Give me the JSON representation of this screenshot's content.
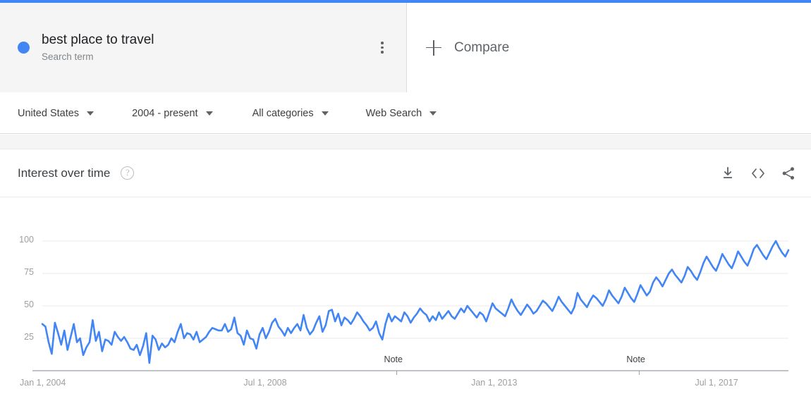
{
  "terms": {
    "items": [
      {
        "title": "best place to travel",
        "subtitle": "Search term",
        "color": "#4285f4",
        "menu_icon": "kebab-menu-icon"
      }
    ],
    "compare_label": "Compare",
    "compare_icon": "plus-icon"
  },
  "filters": [
    {
      "label": "United States",
      "name": "location"
    },
    {
      "label": "2004 - present",
      "name": "time-range"
    },
    {
      "label": "All categories",
      "name": "category"
    },
    {
      "label": "Web Search",
      "name": "search-type"
    }
  ],
  "chart_header": {
    "title": "Interest over time",
    "help_icon": "question-mark-icon",
    "actions": [
      {
        "name": "download-csv-button",
        "icon": "download-icon"
      },
      {
        "name": "embed-button",
        "icon": "code-embed-icon"
      },
      {
        "name": "share-button",
        "icon": "share-icon"
      }
    ]
  },
  "chart_data": {
    "type": "line",
    "title": "Interest over time",
    "xlabel": "",
    "ylabel": "",
    "ylim": [
      0,
      100
    ],
    "yticks": [
      25,
      50,
      75,
      100
    ],
    "grid": true,
    "legend": false,
    "line_color": "#4285f4",
    "xticks": [
      "Jan 1, 2004",
      "Jul 1, 2008",
      "Jan 1, 2013",
      "Jul 1, 2017"
    ],
    "xtick_positions": [
      0,
      0.3,
      0.605,
      0.905
    ],
    "annotations": [
      {
        "label": "Note",
        "position": 0.475
      },
      {
        "label": "Note",
        "position": 0.8
      }
    ],
    "series": [
      {
        "name": "best place to travel",
        "values": [
          36,
          34,
          22,
          13,
          37,
          29,
          20,
          31,
          16,
          26,
          36,
          22,
          25,
          12,
          18,
          22,
          39,
          23,
          30,
          15,
          24,
          23,
          20,
          30,
          26,
          23,
          26,
          22,
          17,
          16,
          20,
          12,
          19,
          29,
          6,
          27,
          24,
          16,
          21,
          18,
          20,
          25,
          22,
          30,
          36,
          25,
          29,
          28,
          24,
          30,
          22,
          24,
          26,
          30,
          33,
          32,
          31,
          31,
          36,
          30,
          32,
          41,
          29,
          27,
          20,
          31,
          25,
          24,
          17,
          28,
          33,
          25,
          30,
          37,
          40,
          34,
          31,
          27,
          33,
          29,
          33,
          36,
          31,
          43,
          33,
          28,
          31,
          37,
          42,
          30,
          35,
          46,
          47,
          38,
          44,
          35,
          41,
          39,
          36,
          40,
          45,
          42,
          38,
          35,
          31,
          33,
          38,
          29,
          24,
          36,
          44,
          38,
          42,
          40,
          38,
          45,
          42,
          37,
          41,
          44,
          48,
          45,
          43,
          38,
          42,
          39,
          45,
          40,
          43,
          46,
          42,
          40,
          44,
          48,
          45,
          50,
          47,
          44,
          41,
          45,
          43,
          38,
          45,
          52,
          48,
          46,
          44,
          42,
          48,
          55,
          50,
          46,
          43,
          47,
          51,
          48,
          44,
          46,
          50,
          54,
          52,
          49,
          46,
          51,
          57,
          53,
          50,
          47,
          44,
          49,
          60,
          55,
          52,
          49,
          54,
          58,
          56,
          53,
          50,
          55,
          62,
          58,
          55,
          52,
          57,
          64,
          60,
          56,
          53,
          59,
          66,
          62,
          58,
          61,
          68,
          72,
          69,
          65,
          70,
          75,
          78,
          74,
          71,
          68,
          73,
          80,
          77,
          73,
          70,
          76,
          83,
          88,
          84,
          80,
          77,
          83,
          90,
          86,
          82,
          79,
          85,
          92,
          88,
          84,
          81,
          87,
          94,
          97,
          93,
          89,
          86,
          91,
          96,
          100,
          95,
          91,
          88,
          93
        ]
      }
    ]
  }
}
